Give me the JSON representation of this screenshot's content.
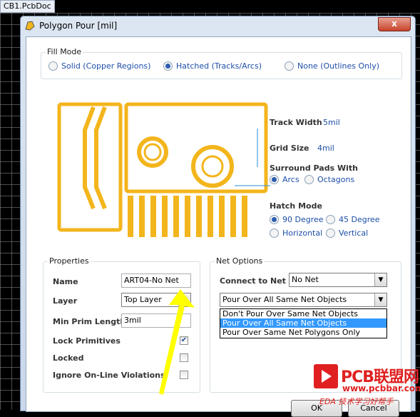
{
  "background": {
    "tab_label": "CB1.PcbDoc"
  },
  "dialog": {
    "title": "Polygon Pour [mil]",
    "close_label": "x"
  },
  "fill_mode": {
    "label": "Fill Mode",
    "options": [
      {
        "label": "Solid (Copper Regions)",
        "selected": false
      },
      {
        "label": "Hatched (Tracks/Arcs)",
        "selected": true
      },
      {
        "label": "None (Outlines Only)",
        "selected": false
      }
    ]
  },
  "hatch_settings": {
    "track_width_label": "Track Width",
    "track_width_value": "5mil",
    "grid_size_label": "Grid Size",
    "grid_size_value": "4mil",
    "surround_label": "Surround Pads With",
    "surround_options": [
      {
        "label": "Arcs",
        "selected": true
      },
      {
        "label": "Octagons",
        "selected": false
      }
    ],
    "hatch_mode_label": "Hatch Mode",
    "hatch_mode_options": [
      {
        "label": "90 Degree",
        "selected": true
      },
      {
        "label": "45 Degree",
        "selected": false
      },
      {
        "label": "Horizontal",
        "selected": false
      },
      {
        "label": "Vertical",
        "selected": false
      }
    ]
  },
  "properties": {
    "label": "Properties",
    "name_label": "Name",
    "name_value": "ART04-No Net",
    "layer_label": "Layer",
    "layer_value": "Top Layer",
    "min_prim_label": "Min Prim Length",
    "min_prim_value": "3mil",
    "lock_primitives_label": "Lock Primitives",
    "lock_primitives_checked": true,
    "locked_label": "Locked",
    "locked_checked": false,
    "ignore_label": "Ignore On-Line Violations",
    "ignore_checked": false
  },
  "net_options": {
    "label": "Net Options",
    "connect_label": "Connect to Net",
    "connect_value": "No Net",
    "pour_value": "Pour Over All Same Net Objects",
    "pour_options": [
      {
        "label": "Don't Pour Over Same Net Objects",
        "selected": false
      },
      {
        "label": "Pour Over All Same Net Objects",
        "selected": true
      },
      {
        "label": "Pour Over Same Net Polygons Only",
        "selected": false
      }
    ]
  },
  "buttons": {
    "ok_label": "OK",
    "cancel_label": "Cancel"
  },
  "watermark": {
    "title": "PCB联盟网",
    "url": "www.pcbbar.com",
    "tagline": "EDA 技术学习好帮手"
  },
  "colors": {
    "copper": "#f3b51c",
    "accent": "#3399ff",
    "annotation_arrow": "#ffff00"
  }
}
